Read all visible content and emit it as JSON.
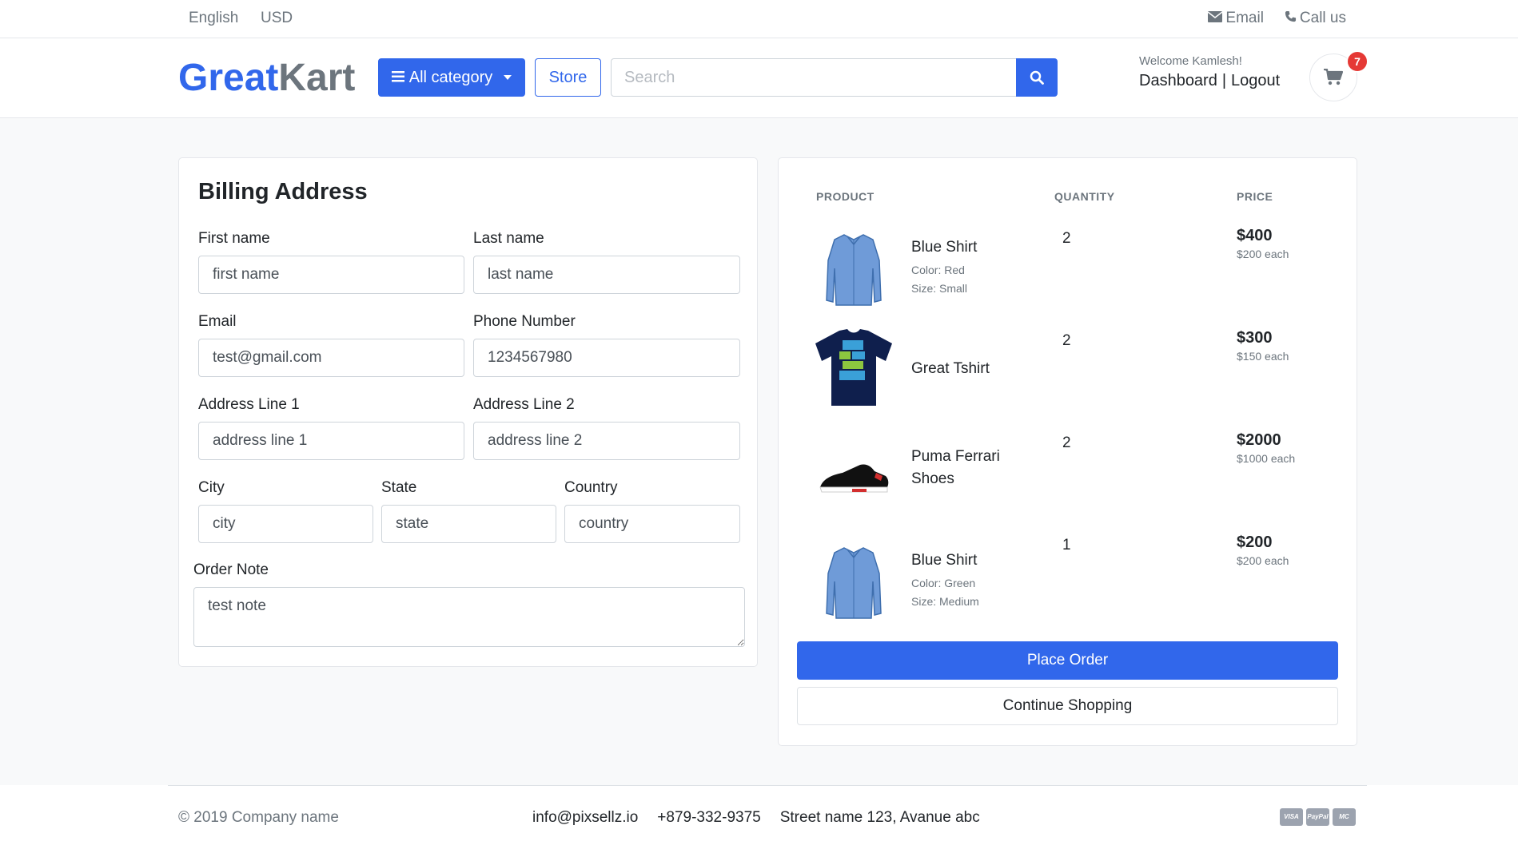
{
  "topbar": {
    "language": "English",
    "currency": "USD",
    "email": "Email",
    "call": "Call us"
  },
  "header": {
    "logo_part1": "Great",
    "logo_part2": "Kart",
    "category_button": "All category",
    "store_button": "Store",
    "search_placeholder": "Search",
    "welcome": "Welcome Kamlesh!",
    "dashboard": "Dashboard",
    "separator": "|",
    "logout": "Logout",
    "cart_count": "7"
  },
  "billing": {
    "title": "Billing Address",
    "first_name_label": "First name",
    "first_name_placeholder": "first name",
    "last_name_label": "Last name",
    "last_name_placeholder": "last name",
    "email_label": "Email",
    "email_value": "test@gmail.com",
    "phone_label": "Phone Number",
    "phone_value": "1234567980",
    "address1_label": "Address Line 1",
    "address1_placeholder": "address line 1",
    "address2_label": "Address Line 2",
    "address2_placeholder": "address line 2",
    "city_label": "City",
    "city_placeholder": "city",
    "state_label": "State",
    "state_placeholder": "state",
    "country_label": "Country",
    "country_placeholder": "country",
    "note_label": "Order Note",
    "note_value": "test note"
  },
  "order": {
    "headers": {
      "product": "PRODUCT",
      "quantity": "QUANTITY",
      "price": "PRICE"
    },
    "items": [
      {
        "name": "Blue Shirt",
        "color": "Color: Red",
        "size": "Size: Small",
        "qty": "2",
        "price": "$400",
        "each": "$200 each",
        "image": "blue-shirt"
      },
      {
        "name": "Great Tshirt",
        "qty": "2",
        "price": "$300",
        "each": "$150 each",
        "image": "navy-tshirt"
      },
      {
        "name": "Puma Ferrari Shoes",
        "qty": "2",
        "price": "$2000",
        "each": "$1000 each",
        "image": "black-shoe"
      },
      {
        "name": "Blue Shirt",
        "color": "Color: Green",
        "size": "Size: Medium",
        "qty": "1",
        "price": "$200",
        "each": "$200 each",
        "image": "blue-shirt"
      }
    ],
    "place_order": "Place Order",
    "continue_shopping": "Continue Shopping"
  },
  "footer": {
    "copyright": "© 2019 Company name",
    "email": "info@pixsellz.io",
    "phone": "+879-332-9375",
    "address": "Street name 123, Avanue abc",
    "payments": [
      "VISA",
      "PayPal",
      "MC"
    ]
  },
  "colors": {
    "primary": "#3167eb",
    "muted": "#6c757d",
    "badge": "#e53935"
  }
}
